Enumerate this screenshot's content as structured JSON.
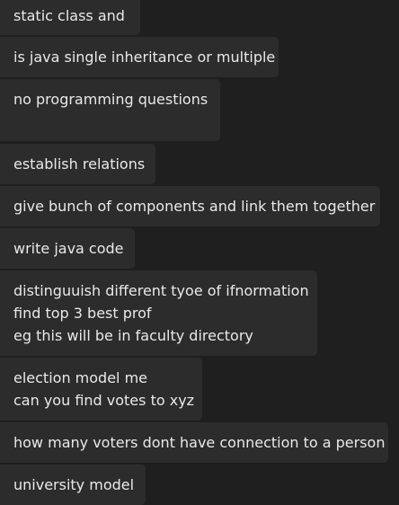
{
  "messages": [
    {
      "lines": [
        "static class and"
      ]
    },
    {
      "lines": [
        "is java single inheritance or multiple"
      ]
    },
    {
      "lines": [
        "no programming questions",
        ""
      ]
    },
    {
      "lines": [
        "establish relations"
      ]
    },
    {
      "lines": [
        "give bunch of components and link them together"
      ]
    },
    {
      "lines": [
        "write java code"
      ]
    },
    {
      "lines": [
        "distinguuish different tyoe of ifnormation",
        "find top 3 best prof",
        "eg this will be in faculty directory"
      ]
    },
    {
      "lines": [
        "election model me",
        "can you find votes to xyz"
      ]
    },
    {
      "lines": [
        "how many voters dont have connection to a person"
      ]
    },
    {
      "lines": [
        "university model"
      ]
    }
  ],
  "colors": {
    "background": "#1f1f1f",
    "bubble": "#2c2c2c",
    "text": "#e9e9e9"
  }
}
